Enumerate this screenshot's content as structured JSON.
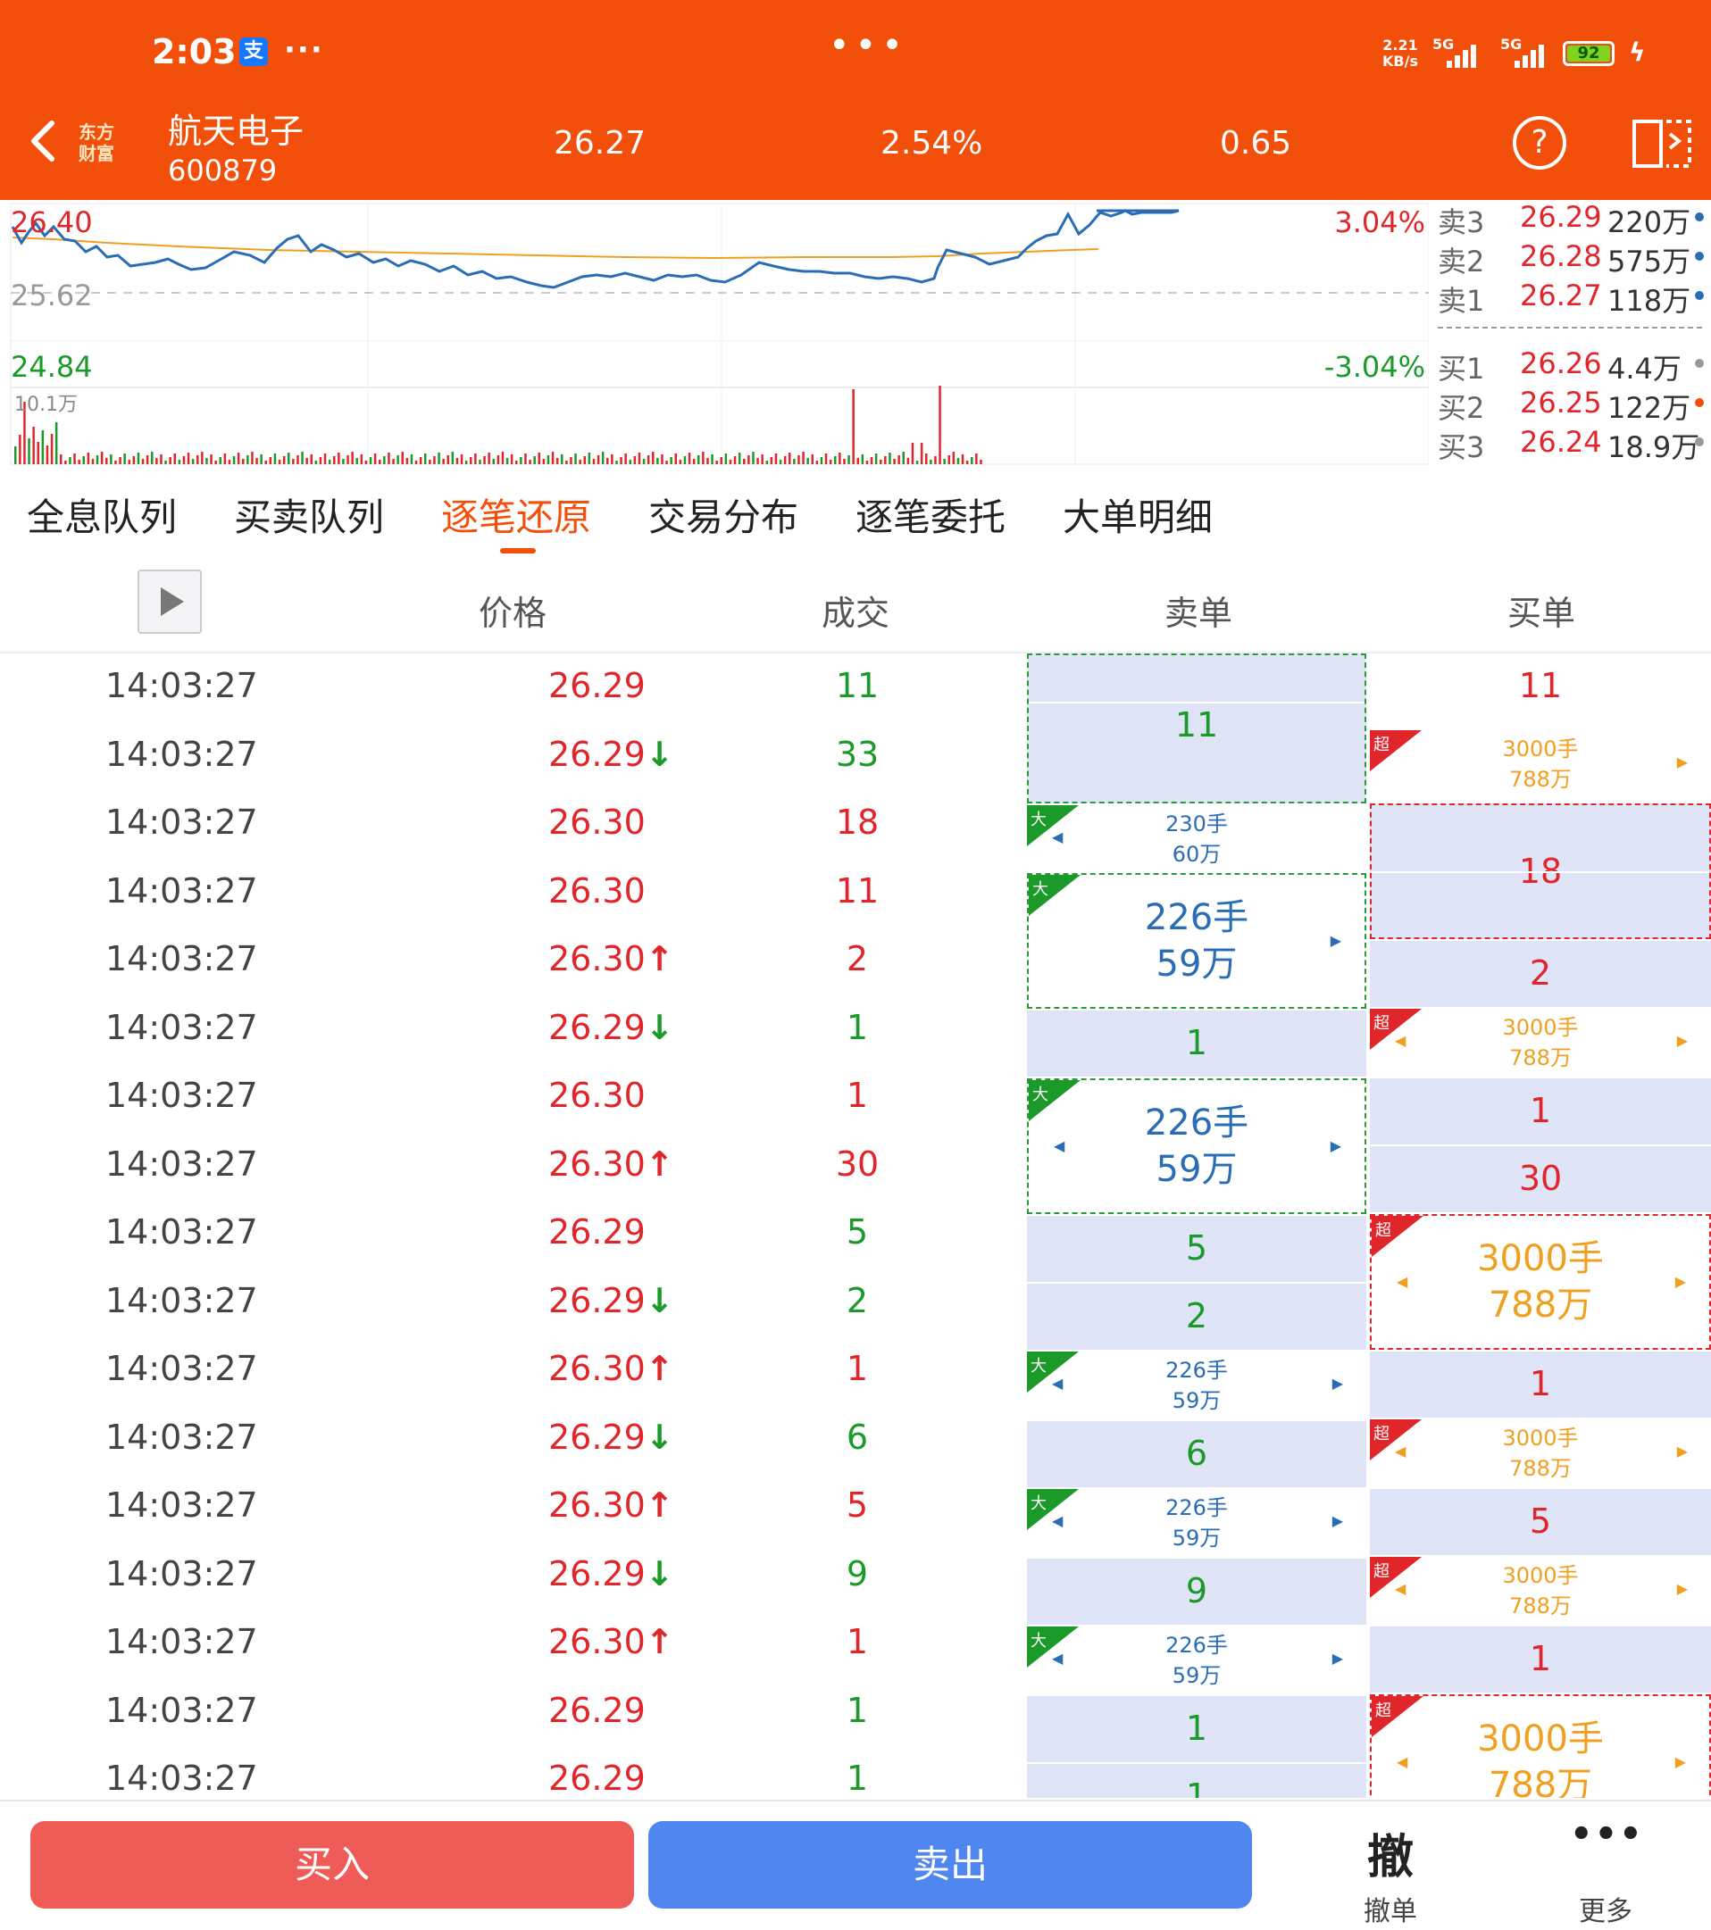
{
  "status_bar": {
    "time": "2:03",
    "alipay_icon": "支",
    "net_speed_top": "2.21",
    "net_speed_bottom": "KB/s",
    "sig1": "5G",
    "sig2": "5G",
    "battery": "92"
  },
  "header": {
    "logo_line1": "东方",
    "logo_line2": "财富",
    "stock_name": "航天电子",
    "stock_code": "600879",
    "price": "26.27",
    "change_pct": "2.54%",
    "change": "0.65"
  },
  "chart": {
    "high_label": "26.40",
    "mid_label": "25.62",
    "low_label": "24.84",
    "high_pct": "3.04%",
    "low_pct": "-3.04%",
    "vol_label": "10.1万",
    "colors": {
      "price_line": "#2a6db5",
      "avg_line": "#f0a020",
      "up": "#e0262a",
      "down": "#1b9a2a"
    }
  },
  "quotes": [
    {
      "label": "卖3",
      "price": "26.29",
      "vol": "220万",
      "dot": "#2a6db5"
    },
    {
      "label": "卖2",
      "price": "26.28",
      "vol": "575万",
      "dot": "#2a6db5"
    },
    {
      "label": "卖1",
      "price": "26.27",
      "vol": "118万",
      "dot": "#2a6db5"
    },
    {
      "label": "买1",
      "price": "26.26",
      "vol": "4.4万",
      "dot": "#999999"
    },
    {
      "label": "买2",
      "price": "26.25",
      "vol": "122万",
      "dot": "#f2500a"
    },
    {
      "label": "买3",
      "price": "26.24",
      "vol": "18.9万",
      "dot": "#999999"
    }
  ],
  "tabs": [
    "全息队列",
    "买卖队列",
    "逐笔还原",
    "交易分布",
    "逐笔委托",
    "大单明细"
  ],
  "active_tab": "逐笔还原",
  "columns": {
    "price": "价格",
    "volume": "成交",
    "sell": "卖单",
    "buy": "买单"
  },
  "trades": [
    {
      "time": "14:03:27",
      "price": "26.29",
      "arrow": "",
      "vol": "11",
      "vc": "green"
    },
    {
      "time": "14:03:27",
      "price": "26.29",
      "arrow": "↓",
      "vol": "33",
      "vc": "green"
    },
    {
      "time": "14:03:27",
      "price": "26.30",
      "arrow": "",
      "vol": "18",
      "vc": "red"
    },
    {
      "time": "14:03:27",
      "price": "26.30",
      "arrow": "",
      "vol": "11",
      "vc": "red"
    },
    {
      "time": "14:03:27",
      "price": "26.30",
      "arrow": "↑",
      "vol": "2",
      "vc": "red"
    },
    {
      "time": "14:03:27",
      "price": "26.29",
      "arrow": "↓",
      "vol": "1",
      "vc": "green"
    },
    {
      "time": "14:03:27",
      "price": "26.30",
      "arrow": "",
      "vol": "1",
      "vc": "red"
    },
    {
      "time": "14:03:27",
      "price": "26.30",
      "arrow": "↑",
      "vol": "30",
      "vc": "red"
    },
    {
      "time": "14:03:27",
      "price": "26.29",
      "arrow": "",
      "vol": "5",
      "vc": "green"
    },
    {
      "time": "14:03:27",
      "price": "26.29",
      "arrow": "↓",
      "vol": "2",
      "vc": "green"
    },
    {
      "time": "14:03:27",
      "price": "26.30",
      "arrow": "↑",
      "vol": "1",
      "vc": "red"
    },
    {
      "time": "14:03:27",
      "price": "26.29",
      "arrow": "↓",
      "vol": "6",
      "vc": "green"
    },
    {
      "time": "14:03:27",
      "price": "26.30",
      "arrow": "↑",
      "vol": "5",
      "vc": "red"
    },
    {
      "time": "14:03:27",
      "price": "26.29",
      "arrow": "↓",
      "vol": "9",
      "vc": "green"
    },
    {
      "time": "14:03:27",
      "price": "26.30",
      "arrow": "↑",
      "vol": "1",
      "vc": "red"
    },
    {
      "time": "14:03:27",
      "price": "26.29",
      "arrow": "",
      "vol": "1",
      "vc": "green"
    },
    {
      "time": "14:03:27",
      "price": "26.29",
      "arrow": "",
      "vol": "1",
      "vc": "green"
    }
  ],
  "order_labels": {
    "big": "大",
    "super": "超",
    "big_hands": "226手",
    "big_amount": "59万",
    "big1_hands": "230手",
    "big1_amount": "60万",
    "super_hands": "3000手",
    "super_amount": "788万"
  },
  "bottom": {
    "buy": "买入",
    "sell": "卖出",
    "cancel_icon": "撤",
    "cancel": "撤单",
    "more": "更多"
  }
}
